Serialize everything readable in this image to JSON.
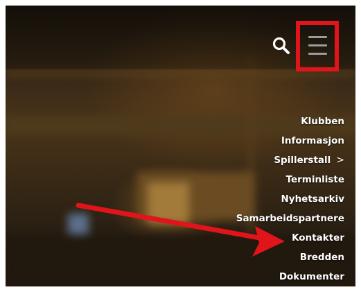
{
  "header": {
    "search_icon": "search-icon",
    "menu_icon": "hamburger-menu-icon"
  },
  "nav": {
    "items": [
      {
        "label": "Klubben"
      },
      {
        "label": "Informasjon"
      },
      {
        "label": "Spillerstall",
        "has_submenu": true,
        "chevron": ">"
      },
      {
        "label": "Terminliste"
      },
      {
        "label": "Nyhetsarkiv"
      },
      {
        "label": "Samarbeidspartnere"
      },
      {
        "label": "Kontakter"
      },
      {
        "label": "Bredden"
      },
      {
        "label": "Dokumenter"
      }
    ]
  },
  "annotation": {
    "highlight_color": "#e0141b",
    "arrow_target": "Kontakter"
  }
}
